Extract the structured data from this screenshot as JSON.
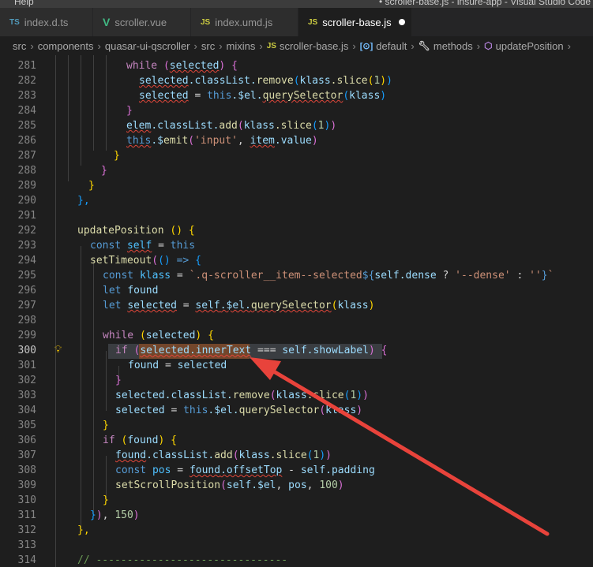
{
  "window": {
    "menu_fragment": "Help",
    "title_fragment": "• scroller-base.js - insure-app - Visual Studio Code"
  },
  "tabs": [
    {
      "icon": "TS",
      "label": "index.d.ts",
      "active": false
    },
    {
      "icon": "V",
      "label": "scroller.vue",
      "active": false
    },
    {
      "icon": "JS",
      "label": "index.umd.js",
      "active": false
    },
    {
      "icon": "JS",
      "label": "scroller-base.js",
      "active": true,
      "dirty": true
    }
  ],
  "breadcrumb": {
    "parts": [
      "src",
      "components",
      "quasar-ui-qscroller",
      "src",
      "mixins"
    ],
    "file": "scroller-base.js",
    "symbol_default": "default",
    "symbol_methods": "methods",
    "symbol_update": "updatePosition"
  },
  "editor": {
    "current_line": "300",
    "line_numbers": [
      "281",
      "282",
      "283",
      "284",
      "285",
      "286",
      "287",
      "288",
      "289",
      "290",
      "291",
      "292",
      "293",
      "294",
      "295",
      "296",
      "297",
      "298",
      "299",
      "300",
      "301",
      "302",
      "303",
      "304",
      "305",
      "306",
      "307",
      "308",
      "309",
      "310",
      "311",
      "312",
      "313",
      "314"
    ],
    "code": {
      "l281_a": "while",
      "l281_b": "selected",
      "l281_c": "{",
      "l282_a": "selected",
      "l282_b": ".classList.",
      "l282_c": "remove",
      "l282_d": "klass",
      "l282_e": ".slice",
      "l282_f": "1",
      "l283_a": "selected",
      "l283_b": "this",
      "l283_c": ".$el.",
      "l283_d": "querySelector",
      "l283_e": "klass",
      "l284_a": "}",
      "l285_a": "elem",
      "l285_b": ".classList.",
      "l285_c": "add",
      "l285_d": "klass",
      "l285_e": ".slice",
      "l285_f": "1",
      "l286_a": "this",
      "l286_b": ".$",
      "l286_c": "emit",
      "l286_d": "'input'",
      "l286_e": "item",
      "l286_f": ".value",
      "l287_a": "}",
      "l288_a": "}",
      "l289_a": "}",
      "l290_a": "},",
      "l292_a": "updatePosition",
      "l292_b": "()",
      "l292_c": "{",
      "l293_a": "const",
      "l293_b": "self",
      "l293_c": "this",
      "l294_a": "setTimeout",
      "l294_b": "(",
      "l294_c": "()",
      "l294_d": "=>",
      "l294_e": "{",
      "l295_a": "const",
      "l295_b": "klass",
      "l295_c": "`.q-scroller__item--selected",
      "l295_d": "self",
      "l295_e": ".dense",
      "l295_f": "'--dense'",
      "l295_g": "''",
      "l295_h": "`",
      "l296_a": "let",
      "l296_b": "found",
      "l297_a": "let",
      "l297_b": "selected",
      "l297_c": "self",
      "l297_d": ".$el.",
      "l297_e": "querySelector",
      "l297_f": "klass",
      "l299_a": "while",
      "l299_b": "selected",
      "l299_c": "{",
      "l300_a": "if",
      "l300_b": "selected",
      "l300_c": ".innerText",
      "l300_d": "===",
      "l300_e": "self",
      "l300_f": ".showLabel",
      "l300_g": "{",
      "l301_a": "found",
      "l301_b": "selected",
      "l302_a": "}",
      "l303_a": "selected",
      "l303_b": ".classList.",
      "l303_c": "remove",
      "l303_d": "klass",
      "l303_e": ".slice",
      "l303_f": "1",
      "l304_a": "selected",
      "l304_b": "this",
      "l304_c": ".$el.",
      "l304_d": "querySelector",
      "l304_e": "klass",
      "l305_a": "}",
      "l306_a": "if",
      "l306_b": "found",
      "l306_c": "{",
      "l307_a": "found",
      "l307_b": ".classList.",
      "l307_c": "add",
      "l307_d": "klass",
      "l307_e": ".slice",
      "l307_f": "1",
      "l308_a": "const",
      "l308_b": "pos",
      "l308_c": "found",
      "l308_d": ".offsetTop",
      "l308_e": "self",
      "l308_f": ".padding",
      "l309_a": "setScrollPosition",
      "l309_b": "self",
      "l309_c": ".$el",
      "l309_d": "pos",
      "l309_e": "100",
      "l310_a": "}",
      "l311_a": "}",
      "l311_b": "150",
      "l312_a": "},",
      "l314_a": "// -------------------------------"
    }
  },
  "colors": {
    "editor_bg": "#1e1e1e",
    "annotation_arrow": "#e8433b"
  },
  "icons": [
    "typescript-icon",
    "vue-icon",
    "javascript-icon",
    "dirty-dot-icon",
    "object-icon",
    "wrench-icon",
    "cube-icon",
    "lightbulb-icon"
  ]
}
